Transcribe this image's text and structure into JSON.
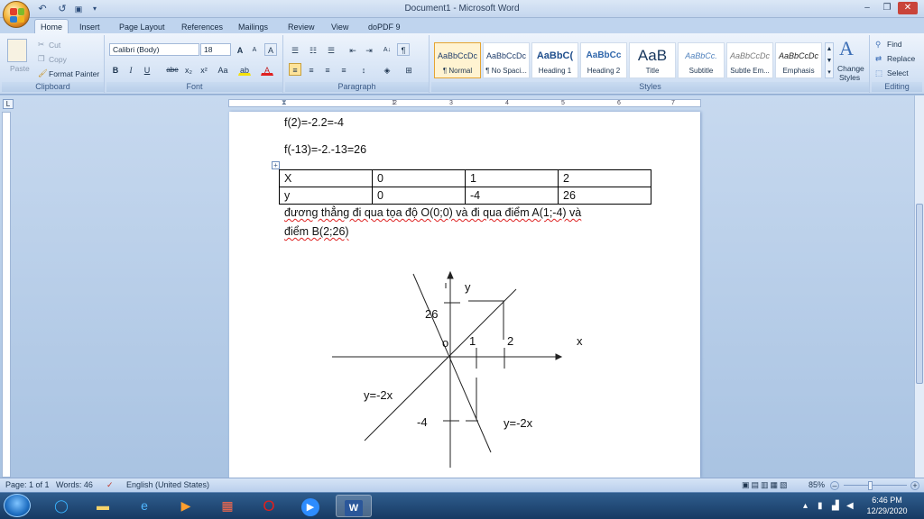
{
  "window": {
    "title": "Document1 - Microsoft Word",
    "controls": {
      "minimize": "–",
      "maximize": "❐",
      "close": "✕"
    }
  },
  "quick_access": {
    "undo": "↶",
    "redo": "↺",
    "save": "▣",
    "customize": "▾"
  },
  "tabs": [
    "Home",
    "Insert",
    "Page Layout",
    "References",
    "Mailings",
    "Review",
    "View",
    "doPDF 9"
  ],
  "ribbon": {
    "clipboard": {
      "label": "Clipboard",
      "paste": "Paste",
      "cut": "Cut",
      "copy": "Copy",
      "format_painter": "Format Painter"
    },
    "font": {
      "label": "Font",
      "name": "Calibri (Body)",
      "size": "18",
      "grow": "A",
      "shrink": "A",
      "clear": "A",
      "bold": "B",
      "italic": "I",
      "underline": "U",
      "strike": "abe",
      "subscript": "x₂",
      "superscript": "x²",
      "change_case": "Aa",
      "highlight": "ab",
      "font_color": "A"
    },
    "paragraph": {
      "label": "Paragraph",
      "sort": "A↓",
      "pilcrow": "¶"
    },
    "styles": {
      "label": "Styles",
      "items": [
        {
          "preview": "AaBbCcDc",
          "name": "¶ Normal",
          "selected": true
        },
        {
          "preview": "AaBbCcDc",
          "name": "¶ No Spaci..."
        },
        {
          "preview": "AaBbC(",
          "name": "Heading 1"
        },
        {
          "preview": "AaBbCc",
          "name": "Heading 2"
        },
        {
          "preview": "AaB",
          "name": "Title"
        },
        {
          "preview": "AaBbCc.",
          "name": "Subtitle"
        },
        {
          "preview": "AaBbCcDc",
          "name": "Subtle Em..."
        },
        {
          "preview": "AaBbCcDc",
          "name": "Emphasis"
        }
      ],
      "change_styles_1": "Change",
      "change_styles_2": "Styles"
    },
    "editing": {
      "label": "Editing",
      "find": "Find",
      "replace": "Replace",
      "select": "Select"
    }
  },
  "ruler": {
    "marks": [
      "1",
      "2",
      "3",
      "4",
      "5",
      "6",
      "7"
    ],
    "corner": "L"
  },
  "document": {
    "line1": "f(2)=-2.2=-4",
    "line2": "f(-13)=-2.-13=26",
    "table": {
      "rows": [
        [
          "X",
          "0",
          "1",
          "2"
        ],
        [
          "y",
          "0",
          "-4",
          "26"
        ]
      ]
    },
    "para_line1": "đương thẳng đi qua tọa độ O(0;0) và đi qua điểm A(1;-4) và",
    "para_line2": "điểm B(2;26)",
    "drawing": {
      "label_y": "y",
      "label_x": "x",
      "label_origin": "o",
      "label_26": "26",
      "label_1": "1",
      "label_2": "2",
      "label_neg4": "-4",
      "label_eq_left": "y=-2x",
      "label_eq_right": "y=-2x"
    }
  },
  "status": {
    "page": "Page: 1 of 1",
    "words": "Words: 46",
    "language": "English (United States)",
    "zoom": "85%"
  },
  "taskbar": {
    "time": "6:46 PM",
    "date": "12/29/2020"
  },
  "colors": {
    "accent": "#2b579a",
    "selection": "#fde39a",
    "opera": "#e0201e",
    "zoom": "#2d8cff"
  }
}
